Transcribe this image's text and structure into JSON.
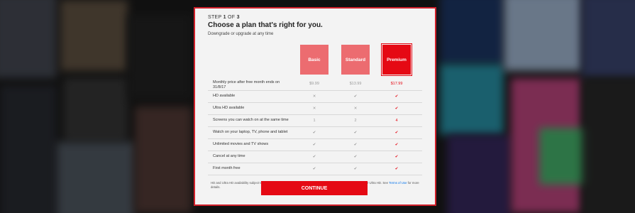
{
  "step": {
    "prefix": "STEP ",
    "current": "1",
    "middle": " OF ",
    "total": "3"
  },
  "title": "Choose a plan that's right for you.",
  "subtitle": "Downgrade or upgrade at any time",
  "plans": [
    {
      "label": "Basic"
    },
    {
      "label": "Standard"
    },
    {
      "label": "Premium",
      "selected": true
    }
  ],
  "rows": [
    {
      "label": "Monthly price after free month ends on 31/8/17",
      "values": [
        "$9.99",
        "$13.99",
        "$17.99"
      ]
    },
    {
      "label": "HD available",
      "values": [
        "✕",
        "✔",
        "✔"
      ]
    },
    {
      "label": "Ultra HD available",
      "values": [
        "✕",
        "✕",
        "✔"
      ]
    },
    {
      "label": "Screens you can watch on at the same time",
      "values": [
        "1",
        "2",
        "4"
      ]
    },
    {
      "label": "Watch on your laptop, TV, phone and tablet",
      "values": [
        "✔",
        "✔",
        "✔"
      ]
    },
    {
      "label": "Unlimited movies and TV shows",
      "values": [
        "✔",
        "✔",
        "✔"
      ]
    },
    {
      "label": "Cancel at any time",
      "values": [
        "✔",
        "✔",
        "✔"
      ]
    },
    {
      "label": "First month free",
      "values": [
        "✔",
        "✔",
        "✔"
      ]
    }
  ],
  "disclaimer": {
    "text": "HD and Ultra HD availability subject to your Internet service and device capabilities. Not all content available in HD or Ultra HD. See ",
    "link": "Terms of Use",
    "suffix": " for more details."
  },
  "continue_label": "CONTINUE",
  "colors": {
    "brand": "#e50914",
    "plan_unselected": "#ec6c70"
  }
}
